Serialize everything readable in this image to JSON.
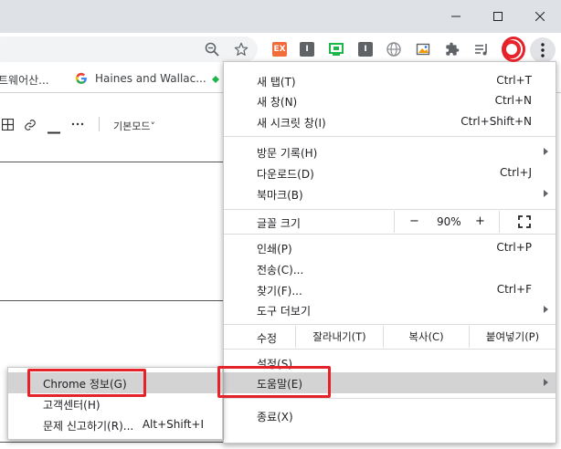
{
  "window": {
    "minimize_icon": "minimize-icon",
    "maximize_icon": "maximize-icon",
    "close_icon": "close-icon"
  },
  "toolbar": {
    "zoom_icon": "zoom-out-magnifier-icon",
    "bookmark_icon": "star-icon",
    "extensions": [
      {
        "name": "ex-extension",
        "label": "EX",
        "color": "#f26b3a"
      },
      {
        "name": "extension-gray-1",
        "label": "I",
        "color": "#5f6368"
      },
      {
        "name": "extension-green",
        "label": "",
        "color": "#1fb54a"
      },
      {
        "name": "extension-gray-2",
        "label": "I",
        "color": "#5f6368"
      }
    ],
    "globe_icon": "globe-icon",
    "image_icon": "image-icon",
    "puzzle_icon": "puzzle-icon",
    "media_icon": "media-queue-icon",
    "profile_color": "#e8232b",
    "menu_icon": "three-dot-menu-icon"
  },
  "bookmarks": {
    "item1": "트웨어산...",
    "item2": "Haines and Wallac..."
  },
  "editor": {
    "style_label": "기본모드˅"
  },
  "menu": {
    "new_tab": {
      "label": "새 탭(T)",
      "shortcut": "Ctrl+T"
    },
    "new_window": {
      "label": "새 창(N)",
      "shortcut": "Ctrl+N"
    },
    "incognito": {
      "label": "새 시크릿 창(I)",
      "shortcut": "Ctrl+Shift+N"
    },
    "history": {
      "label": "방문 기록(H)"
    },
    "downloads": {
      "label": "다운로드(D)",
      "shortcut": "Ctrl+J"
    },
    "bookmarks": {
      "label": "북마크(B)"
    },
    "font_size": {
      "label": "글꼴 크기"
    },
    "zoom": {
      "minus": "−",
      "value": "90%",
      "plus": "+"
    },
    "print": {
      "label": "인쇄(P)",
      "shortcut": "Ctrl+P"
    },
    "cast": {
      "label": "전송(C)..."
    },
    "find": {
      "label": "찾기(F)...",
      "shortcut": "Ctrl+F"
    },
    "more_tools": {
      "label": "도구 더보기"
    },
    "edit": {
      "label": "수정",
      "cut": "잘라내기(T)",
      "copy": "복사(C)",
      "paste": "붙여넣기(P)"
    },
    "settings": {
      "label": "설정(S)"
    },
    "help": {
      "label": "도움말(E)"
    },
    "exit": {
      "label": "종료(X)"
    }
  },
  "help_submenu": {
    "about": {
      "label": "Chrome 정보(G)"
    },
    "help_center": {
      "label": "고객센터(H)"
    },
    "report_issue": {
      "label": "문제 신고하기(R)...",
      "shortcut": "Alt+Shift+I"
    }
  },
  "colors": {
    "annotation_red": "#e4222a",
    "highlight": "#d3d3d3"
  }
}
